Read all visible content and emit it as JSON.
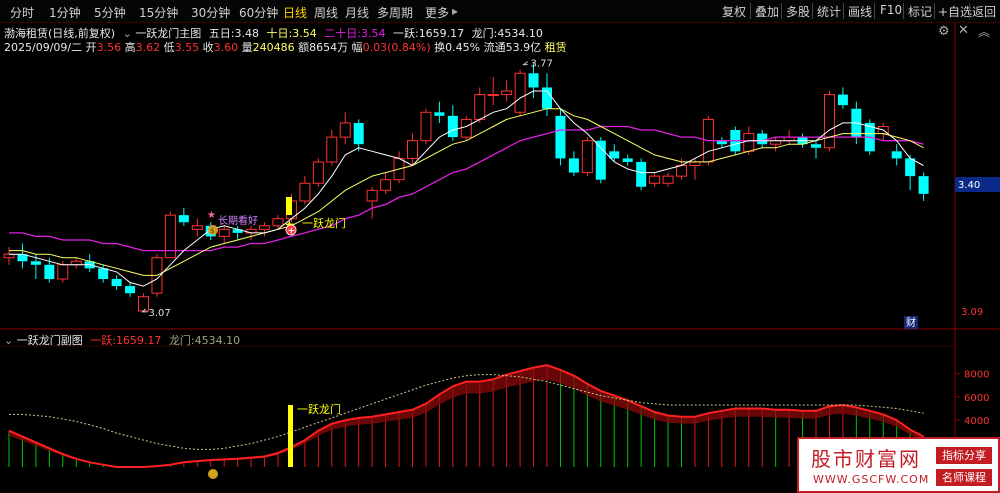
{
  "toolbar": {
    "periods": [
      "分时",
      "1分钟",
      "5分钟",
      "15分钟",
      "30分钟",
      "60分钟",
      "日线",
      "周线",
      "月线",
      "多周期",
      "更多"
    ],
    "active": "日线",
    "more_arrow": "▸",
    "right_buttons": [
      "复权",
      "叠加",
      "多股",
      "统计",
      "画线",
      "F10",
      "标记",
      "+自选",
      "返回"
    ]
  },
  "header": {
    "stock": "渤海租赁",
    "mode": "(日线,前复权)",
    "indicator": "一跃龙门主图",
    "ma5_label": "五日:",
    "ma5": "3.48",
    "ma10_label": "十日:",
    "ma10": "3.54",
    "ma20_label": "二十日:",
    "ma20": "3.54",
    "yiyue_label": "一跃:",
    "yiyue": "1659.17",
    "longmen_label": "龙门:",
    "longmen": "4534.10"
  },
  "quote": {
    "date": "2025/09/09/二",
    "open_label": "开",
    "open": "3.56",
    "high_label": "高",
    "high": "3.62",
    "low_label": "低",
    "low": "3.55",
    "close_label": "收",
    "close": "3.60",
    "vol_label": "量",
    "vol": "240486",
    "amount_label": "额",
    "amount": "8654万",
    "change_label": "幅",
    "change": "0.03(0.84%)",
    "turnover_label": "换",
    "turnover": "0.45%",
    "float_label": "流通",
    "float": "53.9亿",
    "sector": "租赁"
  },
  "annotations": {
    "peak": "3.77",
    "trough": "3.07",
    "signal1": "一跃龙门",
    "signal2": "一跃龙门",
    "fortune": "长期看好",
    "cai_label": "财"
  },
  "price_axis": [
    "3.40",
    "3.09"
  ],
  "subpanel": {
    "title": "一跃龙门副图",
    "yiyue_label": "一跃:",
    "yiyue": "1659.17",
    "longmen_label": "龙门:",
    "longmen": "4534.10",
    "axis": [
      "8000",
      "6000",
      "4000"
    ]
  },
  "watermark": {
    "title": "股市财富网",
    "url": "WWW.GSCFW.COM",
    "tag1": "指标分享",
    "tag2": "名师课程"
  },
  "colors": {
    "up": "#ff3232",
    "down": "#00ffff",
    "ma5": "#ffffff",
    "ma10": "#ffff66",
    "ma20": "#e020e0",
    "signal": "#ffff00",
    "area_red": "#e01818",
    "area_green": "#00c800"
  },
  "chart_data": [
    {
      "type": "candlestick",
      "title": "渤海租赁 (日线,前复权)",
      "ylim": [
        3.05,
        3.8
      ],
      "candles": [
        {
          "o": 3.22,
          "h": 3.25,
          "l": 3.2,
          "c": 3.23
        },
        {
          "o": 3.23,
          "h": 3.26,
          "l": 3.19,
          "c": 3.21
        },
        {
          "o": 3.21,
          "h": 3.23,
          "l": 3.16,
          "c": 3.2
        },
        {
          "o": 3.2,
          "h": 3.22,
          "l": 3.15,
          "c": 3.16
        },
        {
          "o": 3.16,
          "h": 3.21,
          "l": 3.15,
          "c": 3.2
        },
        {
          "o": 3.2,
          "h": 3.22,
          "l": 3.19,
          "c": 3.21
        },
        {
          "o": 3.21,
          "h": 3.23,
          "l": 3.18,
          "c": 3.19
        },
        {
          "o": 3.19,
          "h": 3.2,
          "l": 3.15,
          "c": 3.16
        },
        {
          "o": 3.16,
          "h": 3.17,
          "l": 3.13,
          "c": 3.14
        },
        {
          "o": 3.14,
          "h": 3.15,
          "l": 3.11,
          "c": 3.12
        },
        {
          "o": 3.07,
          "h": 3.12,
          "l": 3.07,
          "c": 3.11
        },
        {
          "o": 3.12,
          "h": 3.23,
          "l": 3.11,
          "c": 3.22
        },
        {
          "o": 3.22,
          "h": 3.35,
          "l": 3.22,
          "c": 3.34
        },
        {
          "o": 3.34,
          "h": 3.36,
          "l": 3.31,
          "c": 3.32
        },
        {
          "o": 3.3,
          "h": 3.33,
          "l": 3.28,
          "c": 3.31
        },
        {
          "o": 3.31,
          "h": 3.32,
          "l": 3.27,
          "c": 3.28
        },
        {
          "o": 3.28,
          "h": 3.31,
          "l": 3.26,
          "c": 3.3
        },
        {
          "o": 3.3,
          "h": 3.31,
          "l": 3.27,
          "c": 3.29
        },
        {
          "o": 3.29,
          "h": 3.31,
          "l": 3.27,
          "c": 3.3
        },
        {
          "o": 3.3,
          "h": 3.32,
          "l": 3.28,
          "c": 3.31
        },
        {
          "o": 3.31,
          "h": 3.34,
          "l": 3.3,
          "c": 3.33
        },
        {
          "o": 3.33,
          "h": 3.4,
          "l": 3.32,
          "c": 3.38
        },
        {
          "o": 3.38,
          "h": 3.45,
          "l": 3.37,
          "c": 3.43
        },
        {
          "o": 3.43,
          "h": 3.5,
          "l": 3.42,
          "c": 3.49
        },
        {
          "o": 3.49,
          "h": 3.58,
          "l": 3.48,
          "c": 3.56
        },
        {
          "o": 3.56,
          "h": 3.63,
          "l": 3.54,
          "c": 3.6
        },
        {
          "o": 3.6,
          "h": 3.61,
          "l": 3.52,
          "c": 3.54
        },
        {
          "o": 3.38,
          "h": 3.42,
          "l": 3.33,
          "c": 3.41
        },
        {
          "o": 3.41,
          "h": 3.46,
          "l": 3.4,
          "c": 3.44
        },
        {
          "o": 3.44,
          "h": 3.52,
          "l": 3.43,
          "c": 3.5
        },
        {
          "o": 3.5,
          "h": 3.57,
          "l": 3.48,
          "c": 3.55
        },
        {
          "o": 3.55,
          "h": 3.64,
          "l": 3.54,
          "c": 3.63
        },
        {
          "o": 3.63,
          "h": 3.66,
          "l": 3.6,
          "c": 3.62
        },
        {
          "o": 3.62,
          "h": 3.65,
          "l": 3.55,
          "c": 3.56
        },
        {
          "o": 3.56,
          "h": 3.62,
          "l": 3.55,
          "c": 3.61
        },
        {
          "o": 3.61,
          "h": 3.7,
          "l": 3.6,
          "c": 3.68
        },
        {
          "o": 3.68,
          "h": 3.73,
          "l": 3.65,
          "c": 3.68
        },
        {
          "o": 3.68,
          "h": 3.72,
          "l": 3.66,
          "c": 3.69
        },
        {
          "o": 3.63,
          "h": 3.75,
          "l": 3.62,
          "c": 3.74
        },
        {
          "o": 3.74,
          "h": 3.77,
          "l": 3.67,
          "c": 3.7
        },
        {
          "o": 3.7,
          "h": 3.74,
          "l": 3.62,
          "c": 3.64
        },
        {
          "o": 3.62,
          "h": 3.64,
          "l": 3.48,
          "c": 3.5
        },
        {
          "o": 3.5,
          "h": 3.52,
          "l": 3.45,
          "c": 3.46
        },
        {
          "o": 3.46,
          "h": 3.56,
          "l": 3.45,
          "c": 3.55
        },
        {
          "o": 3.55,
          "h": 3.56,
          "l": 3.43,
          "c": 3.44
        },
        {
          "o": 3.52,
          "h": 3.54,
          "l": 3.49,
          "c": 3.5
        },
        {
          "o": 3.5,
          "h": 3.51,
          "l": 3.48,
          "c": 3.49
        },
        {
          "o": 3.49,
          "h": 3.5,
          "l": 3.41,
          "c": 3.42
        },
        {
          "o": 3.43,
          "h": 3.46,
          "l": 3.42,
          "c": 3.45
        },
        {
          "o": 3.43,
          "h": 3.46,
          "l": 3.42,
          "c": 3.45
        },
        {
          "o": 3.45,
          "h": 3.5,
          "l": 3.44,
          "c": 3.48
        },
        {
          "o": 3.48,
          "h": 3.5,
          "l": 3.44,
          "c": 3.49
        },
        {
          "o": 3.49,
          "h": 3.62,
          "l": 3.48,
          "c": 3.61
        },
        {
          "o": 3.55,
          "h": 3.56,
          "l": 3.53,
          "c": 3.54
        },
        {
          "o": 3.58,
          "h": 3.59,
          "l": 3.51,
          "c": 3.52
        },
        {
          "o": 3.52,
          "h": 3.59,
          "l": 3.51,
          "c": 3.57
        },
        {
          "o": 3.57,
          "h": 3.58,
          "l": 3.53,
          "c": 3.54
        },
        {
          "o": 3.54,
          "h": 3.56,
          "l": 3.52,
          "c": 3.55
        },
        {
          "o": 3.55,
          "h": 3.58,
          "l": 3.54,
          "c": 3.56
        },
        {
          "o": 3.56,
          "h": 3.57,
          "l": 3.53,
          "c": 3.54
        },
        {
          "o": 3.54,
          "h": 3.55,
          "l": 3.5,
          "c": 3.53
        },
        {
          "o": 3.53,
          "h": 3.69,
          "l": 3.52,
          "c": 3.68
        },
        {
          "o": 3.68,
          "h": 3.7,
          "l": 3.64,
          "c": 3.65
        },
        {
          "o": 3.64,
          "h": 3.66,
          "l": 3.54,
          "c": 3.56
        },
        {
          "o": 3.6,
          "h": 3.61,
          "l": 3.51,
          "c": 3.52
        },
        {
          "o": 3.57,
          "h": 3.6,
          "l": 3.55,
          "c": 3.59
        },
        {
          "o": 3.52,
          "h": 3.54,
          "l": 3.48,
          "c": 3.5
        },
        {
          "o": 3.5,
          "h": 3.51,
          "l": 3.41,
          "c": 3.45
        },
        {
          "o": 3.45,
          "h": 3.46,
          "l": 3.38,
          "c": 3.4
        }
      ],
      "ma5": [
        3.23,
        3.23,
        3.22,
        3.21,
        3.2,
        3.2,
        3.2,
        3.19,
        3.18,
        3.15,
        3.14,
        3.16,
        3.2,
        3.24,
        3.27,
        3.3,
        3.31,
        3.3,
        3.29,
        3.29,
        3.3,
        3.33,
        3.36,
        3.4,
        3.45,
        3.51,
        3.53,
        3.52,
        3.51,
        3.5,
        3.48,
        3.52,
        3.56,
        3.58,
        3.59,
        3.61,
        3.63,
        3.64,
        3.67,
        3.69,
        3.69,
        3.64,
        3.6,
        3.57,
        3.53,
        3.49,
        3.47,
        3.46,
        3.46,
        3.47,
        3.48,
        3.5,
        3.52,
        3.53,
        3.54,
        3.55,
        3.55,
        3.55,
        3.55,
        3.55,
        3.55,
        3.58,
        3.6,
        3.6,
        3.59,
        3.58,
        3.55,
        3.5,
        3.48
      ],
      "ma10": [
        3.24,
        3.24,
        3.23,
        3.23,
        3.22,
        3.22,
        3.21,
        3.2,
        3.19,
        3.18,
        3.17,
        3.17,
        3.19,
        3.21,
        3.23,
        3.25,
        3.26,
        3.27,
        3.28,
        3.29,
        3.3,
        3.31,
        3.33,
        3.35,
        3.38,
        3.41,
        3.43,
        3.45,
        3.46,
        3.47,
        3.48,
        3.5,
        3.52,
        3.54,
        3.55,
        3.57,
        3.59,
        3.61,
        3.62,
        3.63,
        3.64,
        3.64,
        3.62,
        3.61,
        3.59,
        3.57,
        3.55,
        3.53,
        3.51,
        3.5,
        3.49,
        3.49,
        3.49,
        3.5,
        3.51,
        3.52,
        3.53,
        3.53,
        3.54,
        3.54,
        3.55,
        3.56,
        3.57,
        3.57,
        3.57,
        3.57,
        3.56,
        3.55,
        3.53
      ],
      "ma20": [
        3.29,
        3.29,
        3.28,
        3.28,
        3.27,
        3.27,
        3.27,
        3.26,
        3.26,
        3.25,
        3.24,
        3.24,
        3.24,
        3.24,
        3.24,
        3.24,
        3.25,
        3.25,
        3.26,
        3.26,
        3.27,
        3.28,
        3.29,
        3.3,
        3.31,
        3.33,
        3.34,
        3.36,
        3.37,
        3.39,
        3.4,
        3.42,
        3.44,
        3.46,
        3.47,
        3.49,
        3.51,
        3.53,
        3.55,
        3.56,
        3.57,
        3.58,
        3.58,
        3.58,
        3.59,
        3.59,
        3.59,
        3.58,
        3.58,
        3.57,
        3.56,
        3.56,
        3.55,
        3.55,
        3.55,
        3.55,
        3.55,
        3.56,
        3.56,
        3.56,
        3.56,
        3.56,
        3.56,
        3.56,
        3.56,
        3.55,
        3.55,
        3.55,
        3.54
      ]
    },
    {
      "type": "area",
      "title": "一跃龙门副图",
      "ylim": [
        0,
        10000
      ],
      "series": [
        {
          "name": "一跃",
          "values": [
            3100,
            2600,
            2100,
            1600,
            1100,
            700,
            400,
            200,
            0,
            0,
            0,
            80,
            200,
            400,
            500,
            600,
            650,
            700,
            800,
            900,
            1200,
            1700,
            2300,
            3100,
            3700,
            4000,
            4200,
            4300,
            4500,
            4700,
            4900,
            5400,
            6200,
            6900,
            7300,
            7300,
            7500,
            7900,
            8200,
            8500,
            8700,
            8300,
            7800,
            7100,
            6500,
            6100,
            5700,
            5200,
            4700,
            4400,
            4300,
            4300,
            4600,
            4800,
            5000,
            5000,
            5000,
            4900,
            4900,
            4800,
            4800,
            5200,
            5300,
            5100,
            4800,
            4500,
            4000,
            3200,
            2600
          ]
        },
        {
          "name": "龙门",
          "values": [
            4500,
            4500,
            4400,
            4300,
            4100,
            3900,
            3600,
            3300,
            2900,
            2600,
            2300,
            2000,
            1800,
            1600,
            1500,
            1500,
            1600,
            1800,
            2000,
            2300,
            2600,
            3000,
            3400,
            3800,
            4200,
            4600,
            5000,
            5400,
            5800,
            6200,
            6600,
            7000,
            7300,
            7600,
            7800,
            7900,
            7900,
            7800,
            7700,
            7500,
            7300,
            7000,
            6700,
            6400,
            6100,
            5900,
            5700,
            5500,
            5400,
            5300,
            5300,
            5300,
            5300,
            5300,
            5300,
            5300,
            5300,
            5300,
            5300,
            5300,
            5300,
            5300,
            5300,
            5300,
            5200,
            5100,
            5000,
            4800,
            4600
          ]
        }
      ]
    }
  ]
}
